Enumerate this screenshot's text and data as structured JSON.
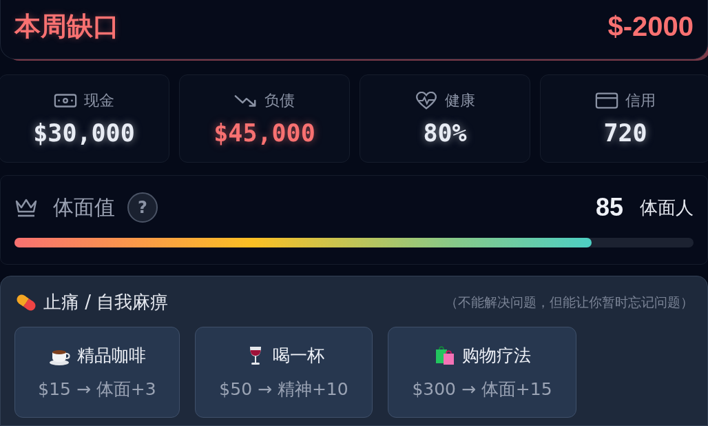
{
  "shortfall": {
    "label": "本周缺口",
    "value": "$-2000"
  },
  "stats": [
    {
      "kind": "cash",
      "label": "现金",
      "value": "$30,000",
      "color": "#e8ecf4"
    },
    {
      "kind": "debt",
      "label": "负债",
      "value": "$45,000",
      "color": "#f87171"
    },
    {
      "kind": "health",
      "label": "健康",
      "value": "80%",
      "color": "#e8ecf4"
    },
    {
      "kind": "credit",
      "label": "信用",
      "value": "720",
      "color": "#e8ecf4"
    }
  ],
  "dignity": {
    "label": "体面值",
    "help": "?",
    "score": "85",
    "rank": "体面人",
    "level": 0.85
  },
  "painkillers": {
    "title": "止痛 / 自我麻痹",
    "note": "（不能解决问题，但能让你暂时忘记问题）",
    "options": [
      {
        "kind": "coffee",
        "name": "精品咖啡",
        "effect": "$15 → 体面+3"
      },
      {
        "kind": "wine",
        "name": "喝一杯",
        "effect": "$50 → 精神+10"
      },
      {
        "kind": "shopping",
        "name": "购物疗法",
        "effect": "$300 → 体面+15"
      }
    ]
  }
}
